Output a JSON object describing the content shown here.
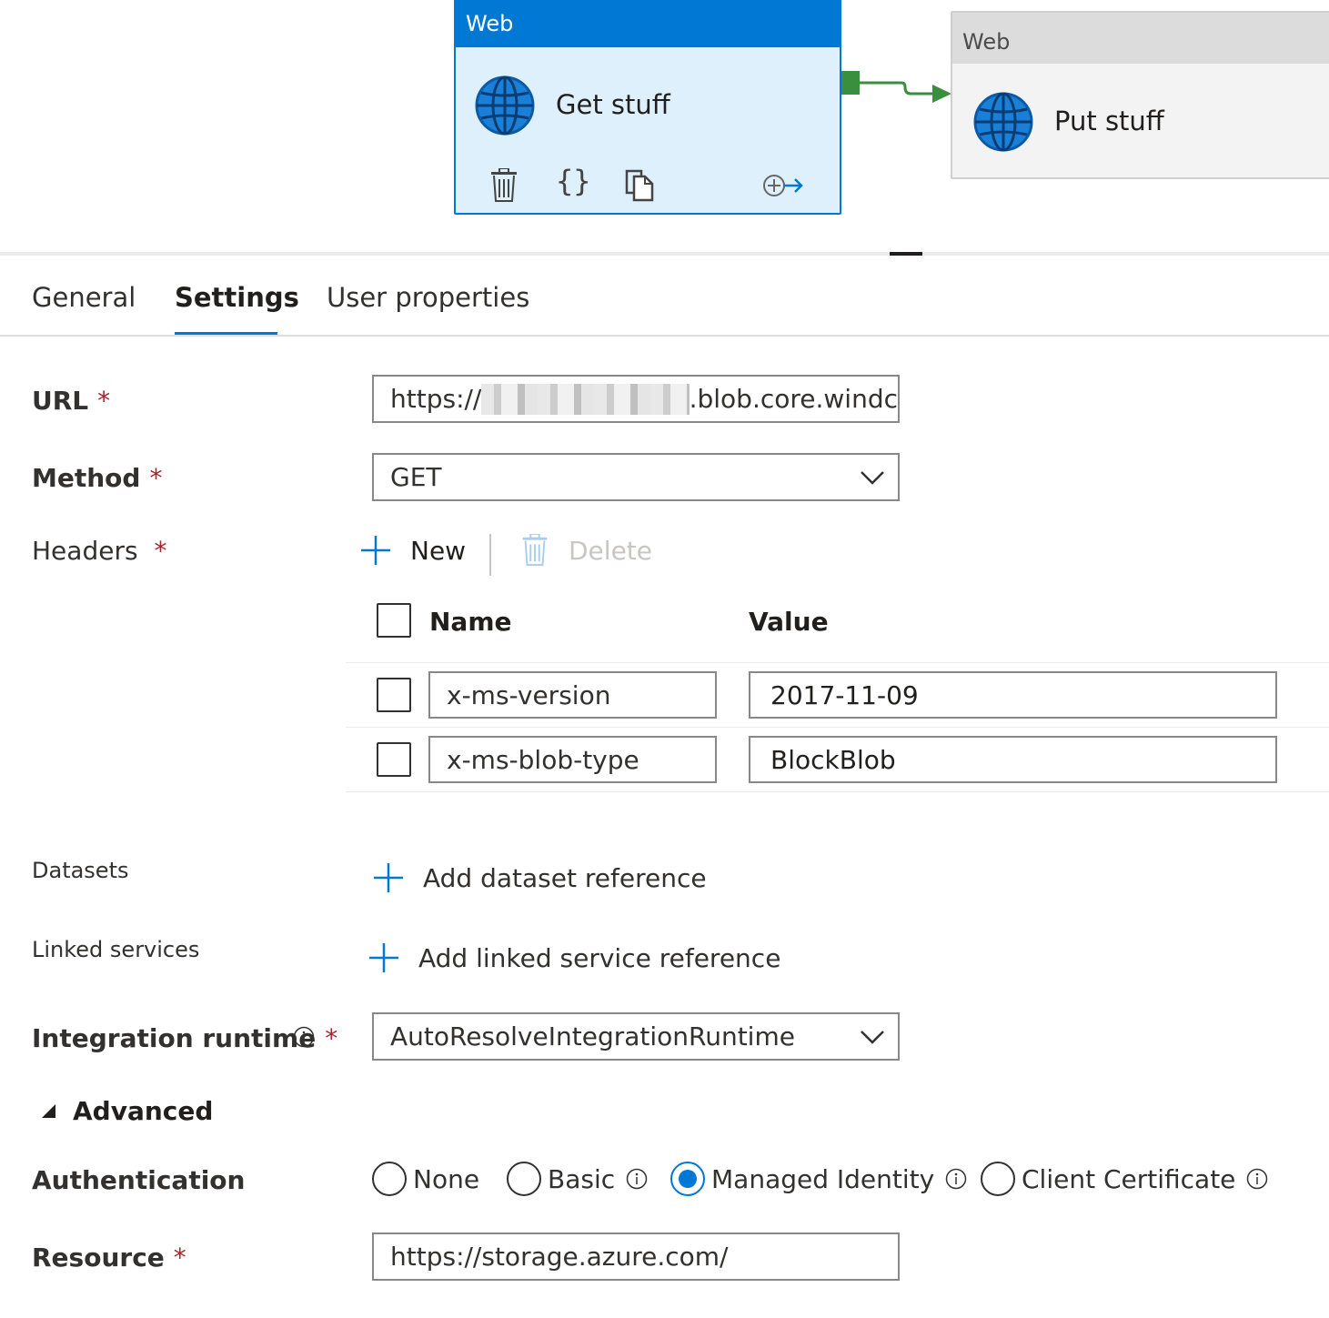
{
  "canvas": {
    "activities": [
      {
        "type_label": "Web",
        "name": "Get stuff",
        "icon": "globe-icon"
      },
      {
        "type_label": "Web",
        "name": "Put stuff",
        "icon": "globe-icon"
      }
    ],
    "toolbar_icons": [
      "delete-icon",
      "code-braces-icon",
      "copy-icon",
      "add-output-icon"
    ]
  },
  "tabs": [
    {
      "label": "General"
    },
    {
      "label": "Settings",
      "active": true
    },
    {
      "label": "User properties"
    }
  ],
  "form": {
    "url": {
      "label": "URL",
      "required_mark": "*",
      "value_prefix": "https://",
      "value_suffix": ".blob.core.windc"
    },
    "method": {
      "label": "Method",
      "required_mark": "*",
      "value": "GET"
    },
    "headers": {
      "label": "Headers",
      "required_mark": "*",
      "new_label": "New",
      "delete_label": "Delete",
      "columns": {
        "name": "Name",
        "value": "Value"
      },
      "rows": [
        {
          "name": "x-ms-version",
          "value": "2017-11-09"
        },
        {
          "name": "x-ms-blob-type",
          "value": "BlockBlob"
        }
      ]
    },
    "datasets": {
      "label": "Datasets",
      "add_label": "Add dataset reference"
    },
    "linked_services": {
      "label": "Linked services",
      "add_label": "Add linked service reference"
    },
    "integration_runtime": {
      "label": "Integration runtime",
      "required_mark": "*",
      "value": "AutoResolveIntegrationRuntime"
    },
    "advanced": {
      "label": "Advanced",
      "expanded": true
    },
    "authentication": {
      "label": "Authentication",
      "options": [
        {
          "label": "None",
          "checked": false,
          "info": false
        },
        {
          "label": "Basic",
          "checked": false,
          "info": true
        },
        {
          "label": "Managed Identity",
          "checked": true,
          "info": true
        },
        {
          "label": "Client Certificate",
          "checked": false,
          "info": true
        }
      ]
    },
    "resource": {
      "label": "Resource",
      "required_mark": "*",
      "value": "https://storage.azure.com/"
    }
  },
  "colors": {
    "accent": "#0078d4",
    "success": "#3a8f3f",
    "required": "#a4262c"
  }
}
